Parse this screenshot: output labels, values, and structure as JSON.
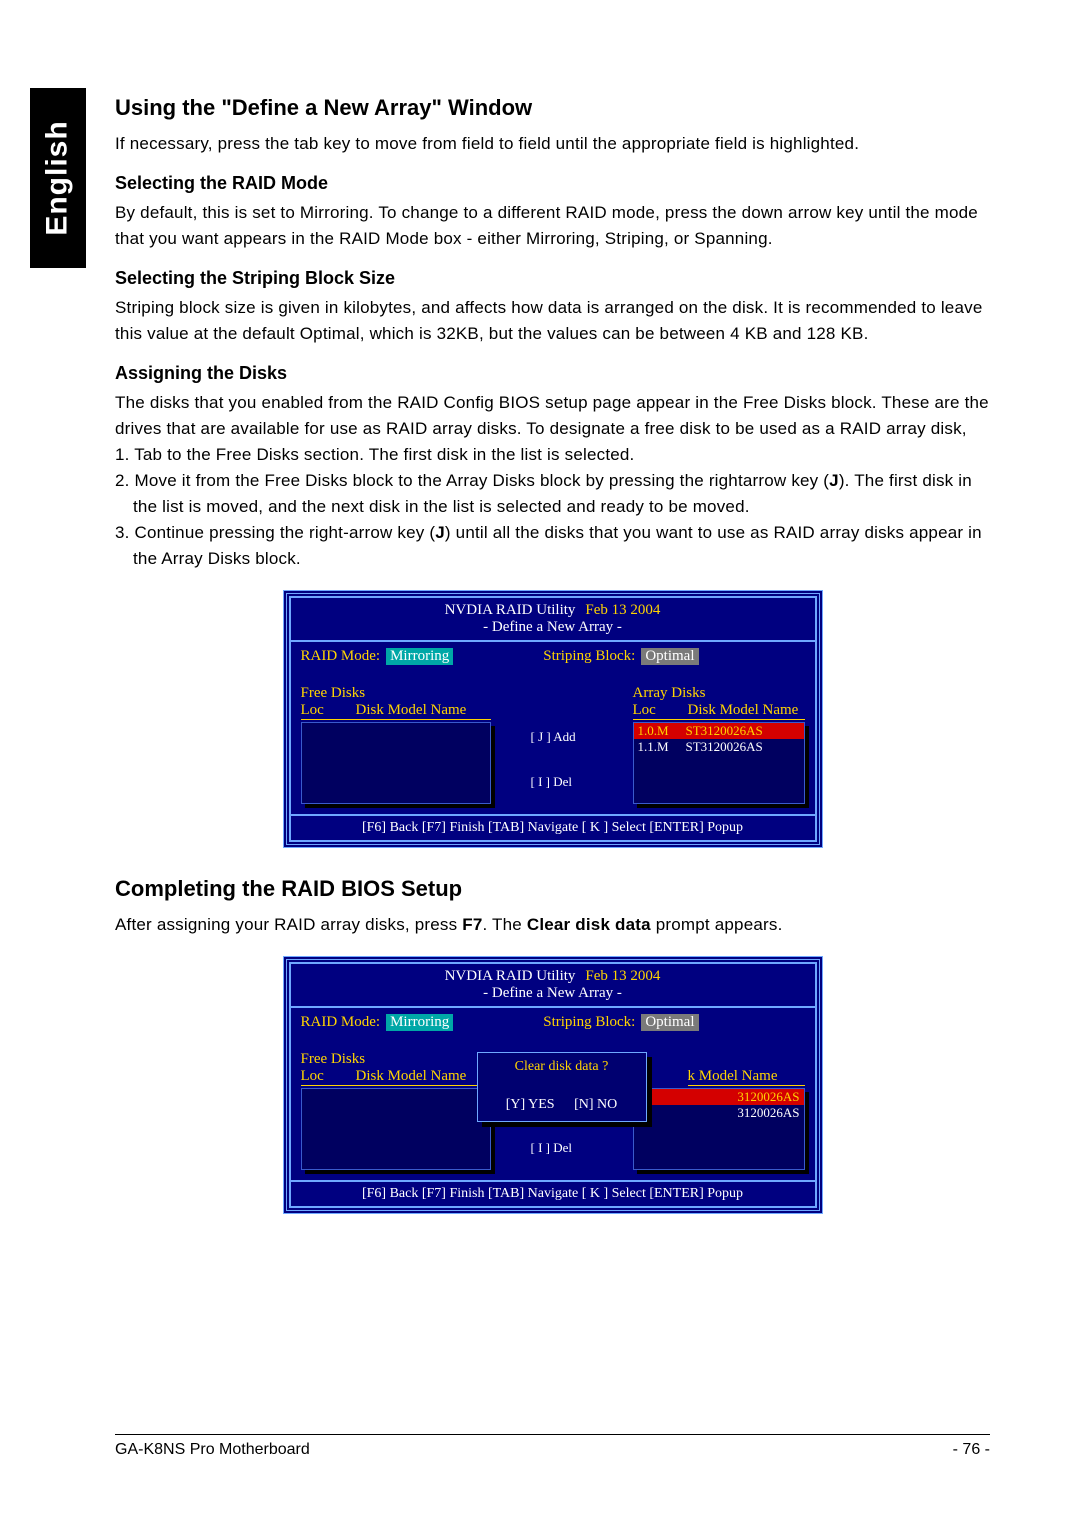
{
  "language_tab": "English",
  "sec1": {
    "title": "Using the \"Define a New Array\" Window",
    "intro": "If necessary, press the tab key to move from field to field until the appropriate field is highlighted.",
    "h_mode": "Selecting the RAID Mode",
    "p_mode": "By default, this is set to Mirroring. To change to a different RAID mode, press the down arrow key until the mode that you want appears in the RAID Mode box - either Mirroring, Striping, or Spanning.",
    "h_block": "Selecting the Striping Block Size",
    "p_block": "Striping block size is given in kilobytes, and affects how data is arranged on the disk. It is recommended to leave this value at the default Optimal, which is 32KB, but the values can be between 4 KB and 128 KB.",
    "h_assign": "Assigning the Disks",
    "p_assign": "The disks that you enabled from the RAID Config BIOS setup page appear in the Free Disks block. These are the drives that are available for use as RAID array disks. To designate a free disk to be used as a RAID array disk,",
    "li1": "1. Tab to the Free Disks section. The first disk in the list is selected.",
    "li2a": "2. Move it from the Free Disks block to the Array Disks block by pressing the rightarrow key (",
    "li2_arrow": "J",
    "li2b": "). The first disk in the list is moved, and the next disk in the list is selected and ready to be moved.",
    "li3a": "3. Continue pressing the right-arrow key (",
    "li3_arrow": "J",
    "li3b": ") until all the disks that you want to use as RAID array disks appear in the Array Disks block."
  },
  "bios": {
    "title_prefix": "NVDIA RAID Utility",
    "title_date": "Feb 13 2004",
    "subtitle": "- Define a New Array -",
    "raid_mode_label": "RAID Mode:",
    "raid_mode_value": "Mirroring",
    "striping_label": "Striping Block:",
    "striping_value": "Optimal",
    "free_disks": "Free Disks",
    "array_disks": "Array Disks",
    "col_loc": "Loc",
    "col_model": "Disk Model Name",
    "add": "[ J ] Add",
    "del": "[ I ] Del",
    "rows": [
      {
        "loc": "1.0.M",
        "model": "ST3120026AS",
        "selected": true
      },
      {
        "loc": "1.1.M",
        "model": "ST3120026AS",
        "selected": false
      }
    ],
    "footer": "[F6] Back   [F7] Finish   [TAB] Navigate   [ K ] Select   [ENTER] Popup"
  },
  "sec2": {
    "title": "Completing the RAID BIOS Setup",
    "p_a": "After assigning your RAID array disks, press ",
    "p_key": "F7",
    "p_b": ". The ",
    "p_bold": "Clear disk data",
    "p_c": " prompt appears."
  },
  "bios2": {
    "popup_q": "Clear disk data ?",
    "yes": "[Y] YES",
    "no": "[N] NO",
    "partial_model_a": "k Model Name",
    "partial_row_a": "3120026AS",
    "partial_row_b": "3120026AS"
  },
  "footer": {
    "name": "GA-K8NS Pro Motherboard",
    "page": "- 76 -"
  }
}
